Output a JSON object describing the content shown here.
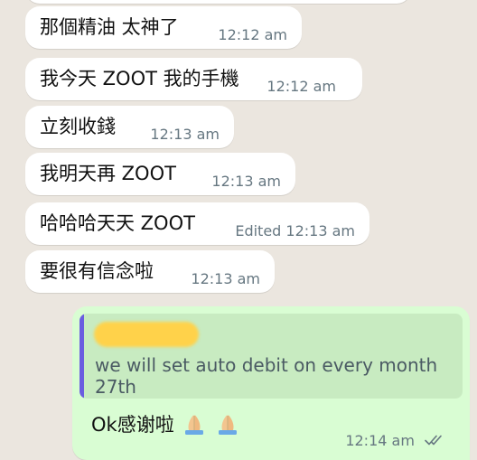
{
  "colors": {
    "background": "#ebe6df",
    "incoming_bubble": "#ffffff",
    "outgoing_bubble": "#d9fdd3",
    "quote_background": "#c8ebc1",
    "quote_bar": "#6a5de0",
    "timestamp": "#667781",
    "read_ticks": "#667781"
  },
  "messages": [
    {
      "text": "那個精油 太神了",
      "time": "12:12 am"
    },
    {
      "text": "我今天 ZOOT 我的手機",
      "time": "12:12 am"
    },
    {
      "text": "立刻收錢",
      "time": "12:13 am"
    },
    {
      "text": "我明天再 ZOOT",
      "time": "12:13 am"
    },
    {
      "text": "哈哈哈天天 ZOOT",
      "time": "Edited 12:13 am"
    },
    {
      "text": "要很有信念啦",
      "time": "12:13 am"
    }
  ],
  "outgoing": {
    "quote": {
      "text": "we will set auto debit on every month 27th"
    },
    "text": "Ok感谢啦",
    "emojis": [
      "folded-hands-icon",
      "folded-hands-icon"
    ],
    "time": "12:14 am",
    "status_icon": "double-check-icon"
  }
}
